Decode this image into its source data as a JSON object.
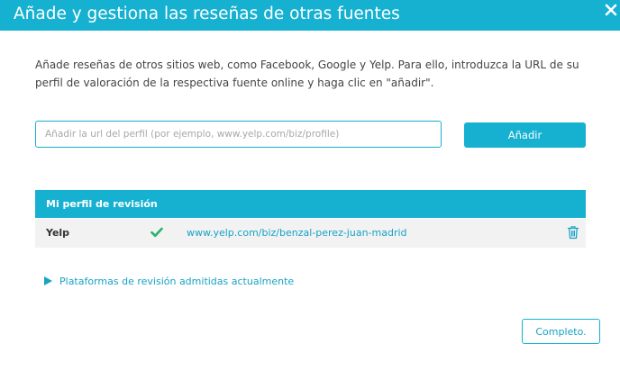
{
  "dialog": {
    "title": "Añade y gestiona las reseñas de otras fuentes",
    "close_icon": "close-icon",
    "description": "Añade reseñas de otros sitios web, como Facebook, Google y Yelp. Para ello, introduzca la URL de su perfil de valoración de la respectiva fuente online y haga clic en \"añadir\"."
  },
  "form": {
    "url_input_value": "",
    "url_input_placeholder": "Añadir la url del perfil (por ejemplo, www.yelp.com/biz/profile)",
    "add_button_label": "Añadir"
  },
  "profiles_table": {
    "header": "Mi perfil de revisión",
    "rows": [
      {
        "source": "Yelp",
        "status_icon": "check-icon",
        "url": "www.yelp.com/biz/benzal-perez-juan-madrid",
        "delete_icon": "trash-icon"
      }
    ]
  },
  "platforms_toggle": {
    "label": "Plataformas de revisión admitidas actualmente",
    "icon": "triangle-right-icon"
  },
  "footer": {
    "done_button_label": "Completo."
  },
  "colors": {
    "accent": "#16b1d1",
    "link": "#16a3c6",
    "success": "#27b36b",
    "row_background": "#f2f2f2"
  }
}
